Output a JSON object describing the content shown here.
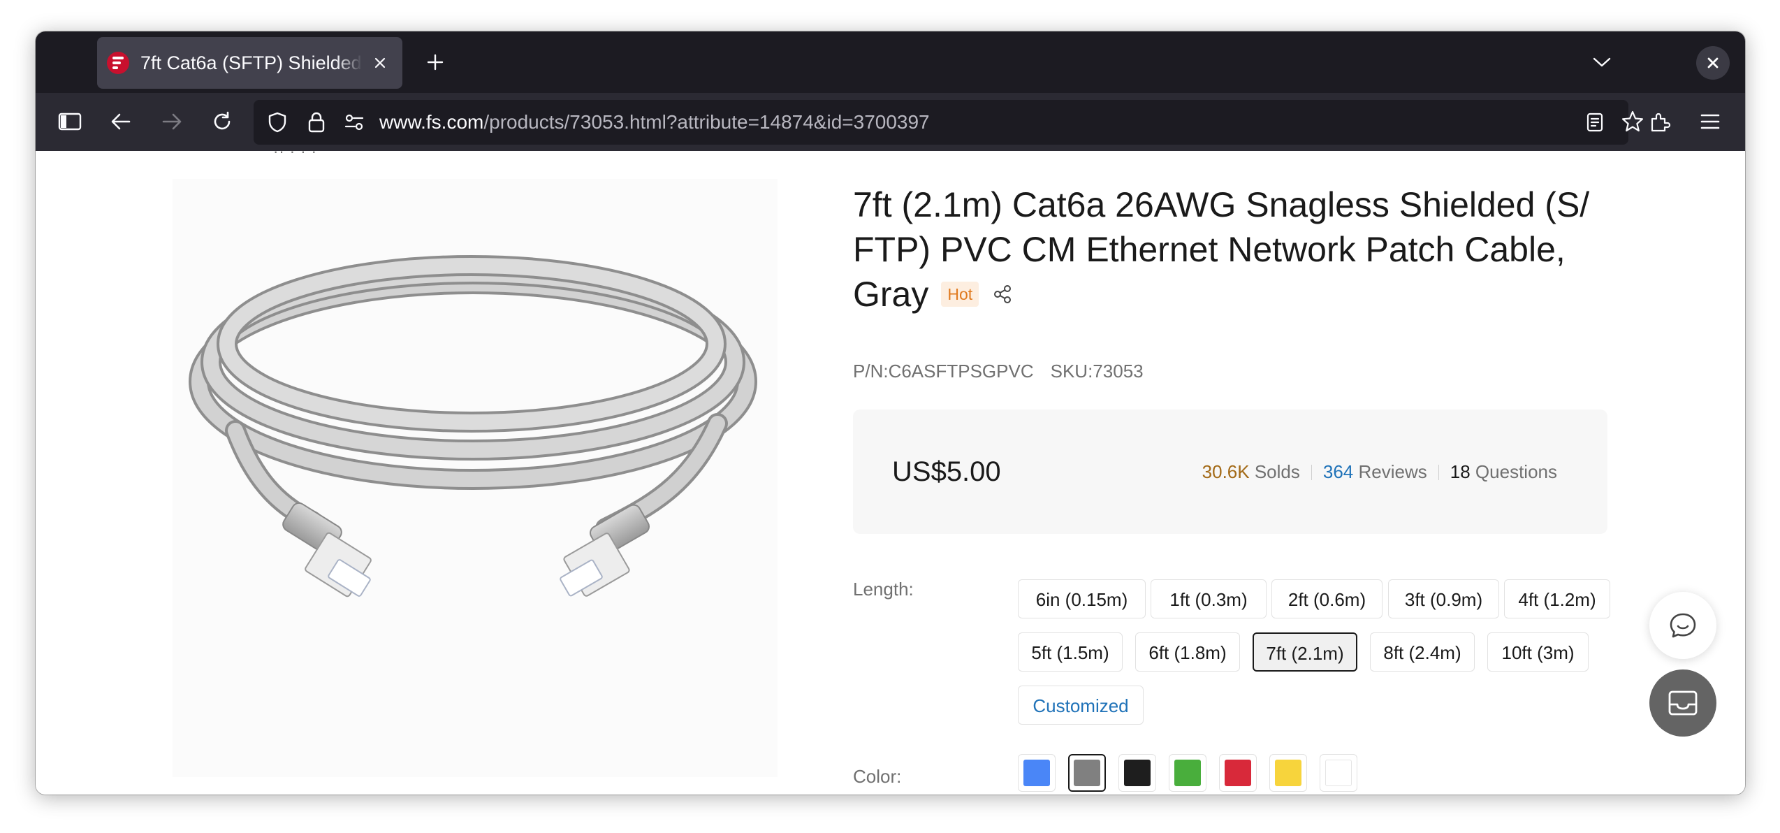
{
  "browser": {
    "tab_title": "7ft Cat6a (SFTP) Shielded",
    "url_host": "www.fs.com",
    "url_path": "/products/73053.html?attribute=14874&id=3700397"
  },
  "product": {
    "title_main": "7ft (2.1m) Cat6a 26AWG Snagless Shielded (S/ FTP) PVC CM Ethernet Network Patch Cable,",
    "title_last_word": "Gray",
    "badge": "Hot",
    "pn": "P/N:C6ASFTPSGPVC",
    "sku": "SKU:73053",
    "price": "US$5.00",
    "stats": {
      "solds_count": "30.6K",
      "solds_label": "Solds",
      "reviews_count": "364",
      "reviews_label": "Reviews",
      "questions_count": "18",
      "questions_label": "Questions"
    },
    "length_label": "Length:",
    "length_options": [
      "6in (0.15m)",
      "1ft (0.3m)",
      "2ft (0.6m)",
      "3ft (0.9m)",
      "4ft (1.2m)",
      "5ft (1.5m)",
      "6ft (1.8m)",
      "7ft (2.1m)",
      "8ft (2.4m)",
      "10ft (3m)",
      "Customized"
    ],
    "length_selected": "7ft (2.1m)",
    "color_label": "Color:",
    "color_swatches": [
      {
        "name": "blue",
        "hex": "#4a86f7"
      },
      {
        "name": "gray",
        "hex": "#808080",
        "selected": true
      },
      {
        "name": "black",
        "hex": "#1e1e1e"
      },
      {
        "name": "green",
        "hex": "#49ae3c"
      },
      {
        "name": "red",
        "hex": "#d8293a"
      },
      {
        "name": "yellow",
        "hex": "#f7d43c"
      },
      {
        "name": "white",
        "hex": "#ffffff"
      }
    ]
  },
  "colors": {
    "brand_red": "#c8102e",
    "link_blue": "#1f72b8",
    "solds_gold": "#a36a17",
    "hot_orange": "#e07a1f"
  }
}
